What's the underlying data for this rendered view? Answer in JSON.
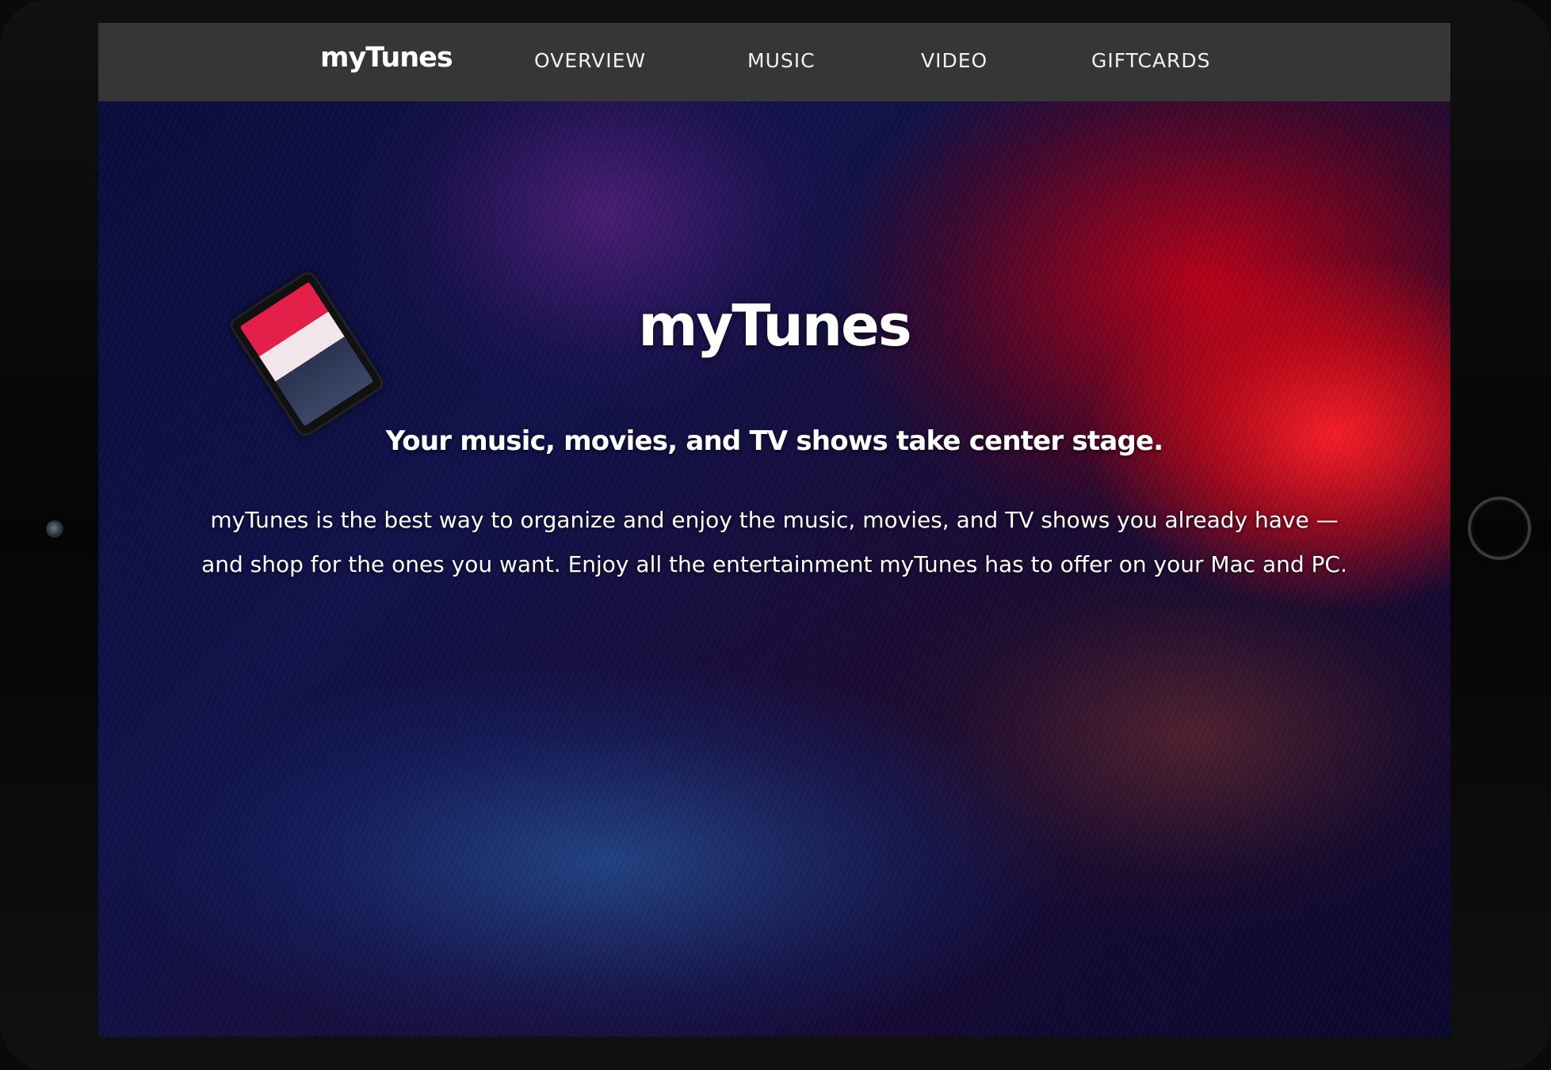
{
  "navbar": {
    "logo": "myTunes",
    "links": [
      "OVERVIEW",
      "MUSIC",
      "VIDEO",
      "GIFTCARDS"
    ]
  },
  "hero": {
    "title": "myTunes",
    "subtitle": "Your music, movies, and TV shows take center stage.",
    "body_lines": [
      "myTunes is the best way to organize and enjoy the music, movies, and TV shows you already have —",
      "and shop for the ones you want. Enjoy all the entertainment myTunes has to offer on your Mac and PC."
    ]
  },
  "colors": {
    "navbar_bg": "#363636",
    "text": "#ffffff",
    "hero_red": "#e0101e",
    "hero_blue": "#10124a"
  }
}
